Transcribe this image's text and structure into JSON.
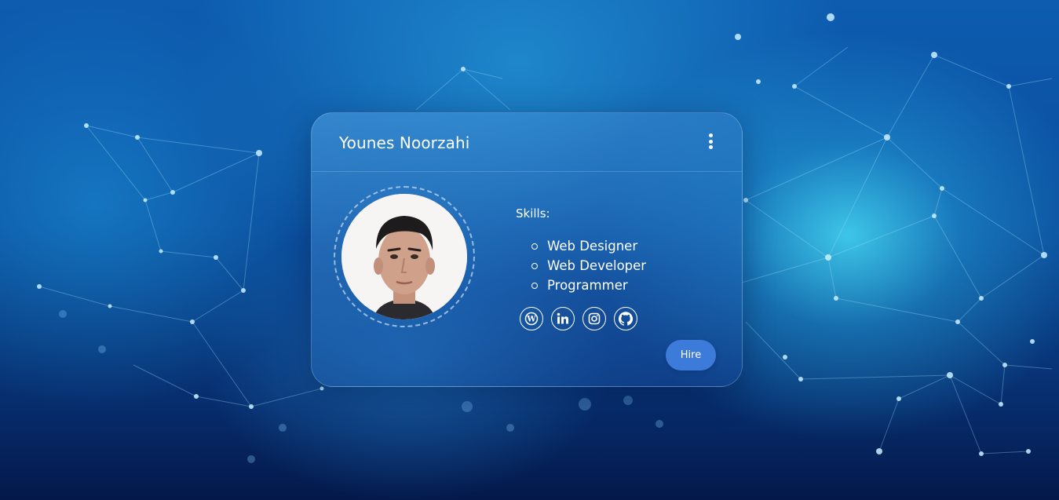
{
  "profile": {
    "name": "Younes Noorzahi",
    "skills_title": "Skills:",
    "skills": [
      "Web Designer",
      "Web Developer",
      "Programmer"
    ],
    "hire_label": "Hire"
  },
  "socials": [
    {
      "icon": "wordpress-icon"
    },
    {
      "icon": "linkedin-icon"
    },
    {
      "icon": "instagram-icon"
    },
    {
      "icon": "github-icon"
    }
  ],
  "colors": {
    "accent": "#3c7bd9",
    "card_tint": "#3a86cc",
    "background": "#0a4c9c"
  }
}
